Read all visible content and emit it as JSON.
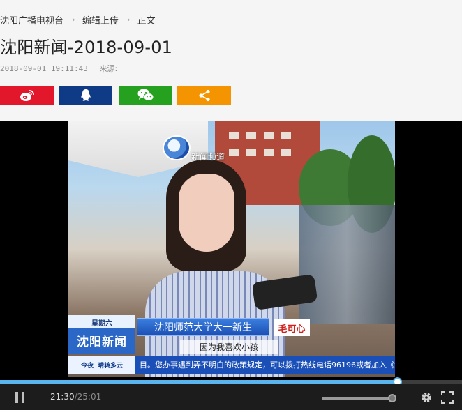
{
  "breadcrumb": {
    "items": [
      "沈阳广播电视台",
      "编辑上传",
      "正文"
    ],
    "separator": "›"
  },
  "article": {
    "title": "沈阳新闻-2018-09-01",
    "datetime": "2018-09-01 19:11:43",
    "source_label": "来源:"
  },
  "share": {
    "buttons": [
      {
        "icon": "weibo-icon",
        "color": "#e3172c"
      },
      {
        "icon": "qq-icon",
        "color": "#0f3a86"
      },
      {
        "icon": "wechat-icon",
        "color": "#26a11f"
      },
      {
        "icon": "share-icon",
        "color": "#f39400"
      }
    ]
  },
  "video": {
    "channel_name": "新闻频道",
    "day": "星期六",
    "show_name": "沈阳新闻",
    "name_bar": "沈阳师范大学大一新生",
    "person_name": "毛可心",
    "caption": "因为我喜欢小孩",
    "ticker_left_1": "今夜",
    "ticker_left_2": "晴转多云",
    "ticker_text": "目。您办事遇到弄不明白的政策规定，可以拨打热线电话96196或者加入《沈阳"
  },
  "player": {
    "current_time": "21:30",
    "separator": "/",
    "total_time": "25:01",
    "progress_fraction": 0.86,
    "volume_fraction": 0.94,
    "accent_color": "#5ab4ee"
  }
}
